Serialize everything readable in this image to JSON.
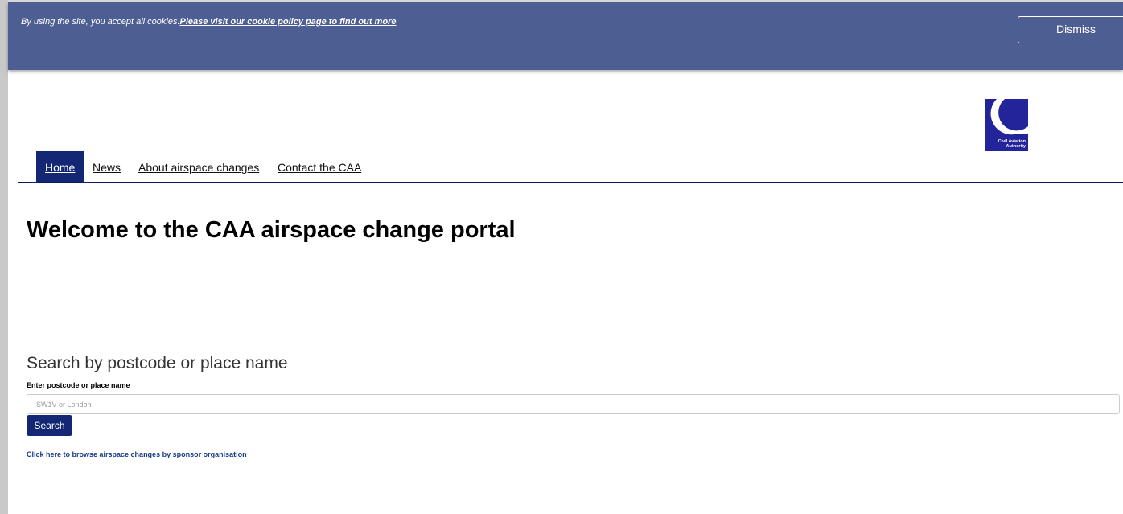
{
  "cookie_banner": {
    "text": "By using the site, you accept all cookies.",
    "link_text": "Please visit our cookie policy page to find out more",
    "dismiss_label": "Dismiss"
  },
  "logo": {
    "line1": "Civil Aviation",
    "line2": "Authority"
  },
  "nav": {
    "items": [
      {
        "label": "Home",
        "active": true
      },
      {
        "label": "News",
        "active": false
      },
      {
        "label": "About airspace changes",
        "active": false
      },
      {
        "label": "Contact the CAA",
        "active": false
      }
    ]
  },
  "main": {
    "title": "Welcome to the CAA airspace change portal"
  },
  "search": {
    "heading": "Search by postcode or place name",
    "label": "Enter postcode or place name",
    "placeholder": "SW1V or London",
    "value": "",
    "button_label": "Search",
    "browse_link": "Click here to browse airspace changes by sponsor organisation"
  },
  "colors": {
    "banner": "#4d5e93",
    "brand_navy": "#132775",
    "logo_blue": "#23239a"
  }
}
